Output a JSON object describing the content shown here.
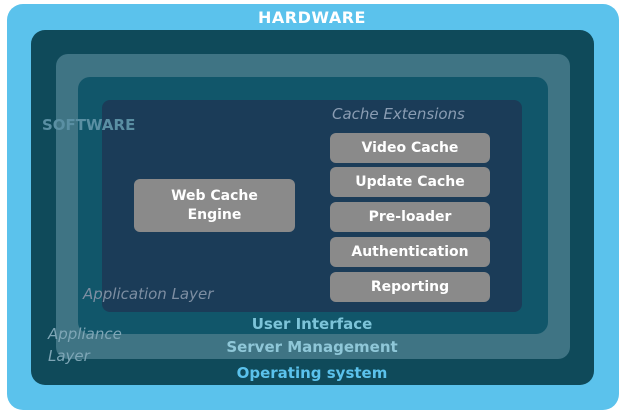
{
  "layers": {
    "hardware": "HARDWARE",
    "software": "SOFTWARE",
    "operating_system": "Operating system",
    "server_management": "Server Management",
    "user_interface": "User Interface",
    "application_layer": "Application Layer",
    "appliance_layer": "Appliance Layer"
  },
  "engine": {
    "label": "Web Cache\nEngine"
  },
  "extensions": {
    "title": "Cache Extensions",
    "items": [
      "Video Cache",
      "Update Cache",
      "Pre-loader",
      "Authentication",
      "Reporting"
    ]
  }
}
